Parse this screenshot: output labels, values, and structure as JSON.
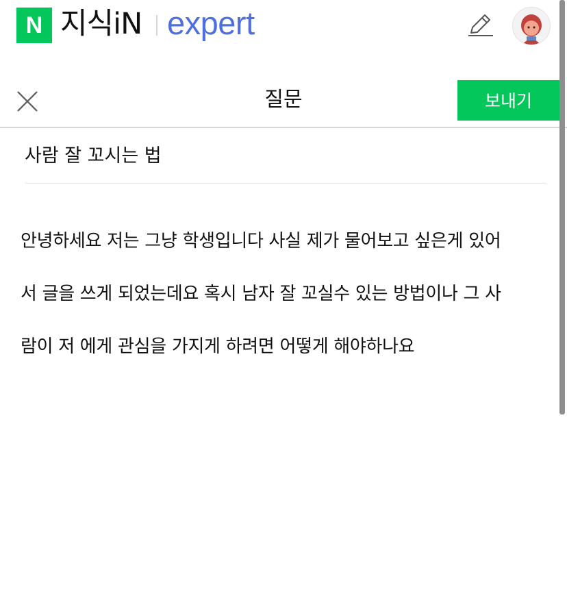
{
  "brand": {
    "logo_letter": "N",
    "name": "지식iN",
    "sub": "expert",
    "accent": "#03c75a",
    "expert_color": "#4f6fe0"
  },
  "header": {
    "title": "질문",
    "send_label": "보내기"
  },
  "question": {
    "title": "사람 잘 꼬시는 법",
    "body_lines": [
      "안녕하세요 저는 그냥 학생입니다 사실 제가 물어보고 싶은게 있어",
      "서 글을 쓰게 되었는데요 혹시 남자 잘 꼬실수 있는 방법이나 그 사",
      "람이 저 에게 관심을 가지게 하려면 어떻게 해야하나요"
    ]
  },
  "icons": {
    "edit": "pencil-icon",
    "close": "close-icon",
    "avatar": "avatar-icon"
  }
}
